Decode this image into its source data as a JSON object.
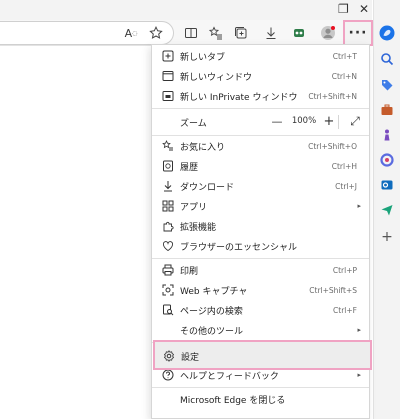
{
  "window": {
    "restore_glyph": "❐",
    "close_glyph": "✕"
  },
  "toolbar": {
    "read_aloud_label": "A",
    "more_label": "···"
  },
  "menu": {
    "items": [
      {
        "label": "新しいタブ",
        "shortcut": "Ctrl+T",
        "icon": "new-tab-icon"
      },
      {
        "label": "新しいウィンドウ",
        "shortcut": "Ctrl+N",
        "icon": "new-window-icon"
      },
      {
        "label": "新しい InPrivate ウィンドウ",
        "shortcut": "Ctrl+Shift+N",
        "icon": "inprivate-icon"
      }
    ],
    "zoom": {
      "label": "ズーム",
      "minus": "—",
      "value": "100%",
      "plus": "+",
      "fullscreen": "⤢"
    },
    "items2": [
      {
        "label": "お気に入り",
        "shortcut": "Ctrl+Shift+O",
        "icon": "favorites-icon"
      },
      {
        "label": "履歴",
        "shortcut": "Ctrl+H",
        "icon": "history-icon"
      },
      {
        "label": "ダウンロード",
        "shortcut": "Ctrl+J",
        "icon": "download-icon"
      },
      {
        "label": "アプリ",
        "shortcut": "",
        "icon": "apps-icon",
        "submenu": "▸"
      },
      {
        "label": "拡張機能",
        "shortcut": "",
        "icon": "extensions-icon"
      },
      {
        "label": "ブラウザーのエッセンシャル",
        "shortcut": "",
        "icon": "browser-essentials-icon"
      }
    ],
    "items3": [
      {
        "label": "印刷",
        "shortcut": "Ctrl+P",
        "icon": "print-icon"
      },
      {
        "label": "Web キャプチャ",
        "shortcut": "Ctrl+Shift+S",
        "icon": "web-capture-icon"
      },
      {
        "label": "ページ内の検索",
        "shortcut": "Ctrl+F",
        "icon": "find-icon"
      },
      {
        "label": "その他のツール",
        "shortcut": "",
        "icon": "",
        "submenu": "▸"
      }
    ],
    "items4": [
      {
        "label": "設定",
        "shortcut": "",
        "icon": "settings-icon"
      },
      {
        "label": "ヘルプとフィードバック",
        "shortcut": "",
        "icon": "help-icon",
        "submenu": "▸"
      }
    ],
    "close_label": "Microsoft Edge を閉じる"
  },
  "colors": {
    "highlight": "#f0a3c3",
    "menu_bg": "#ffffff",
    "hover_bg": "#ededed"
  }
}
